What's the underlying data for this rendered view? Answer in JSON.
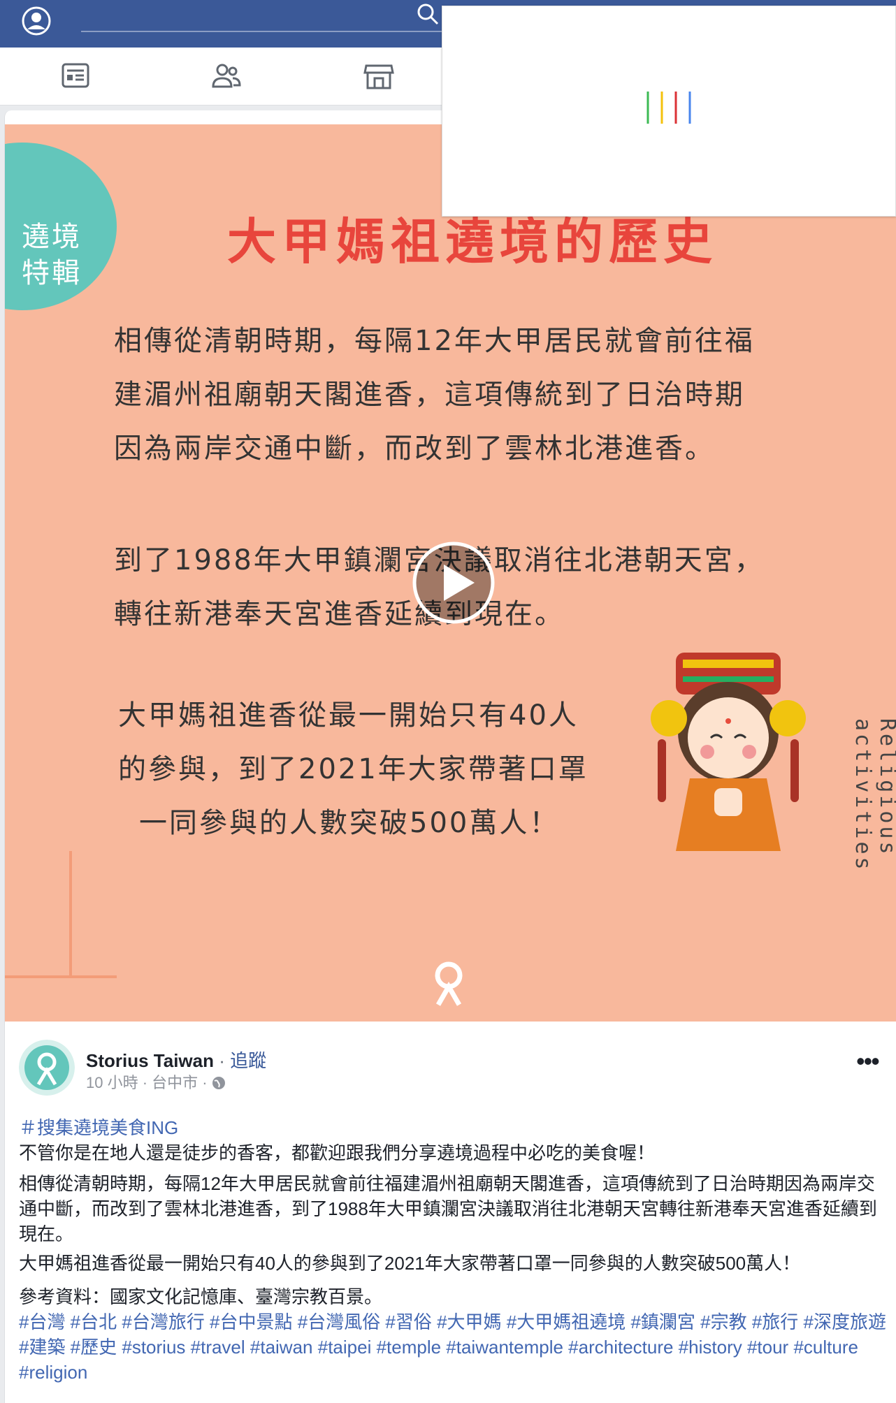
{
  "nav": {
    "icons": [
      "profile-icon",
      "search-icon",
      "news-feed-icon",
      "friends-icon",
      "marketplace-icon"
    ]
  },
  "video": {
    "badge": [
      "遶境",
      "特輯"
    ],
    "title": "大甲媽祖遶境的歷史",
    "para1": [
      "相傳從清朝時期，每隔12年大甲居民就會前往福",
      "建湄州祖廟朝天閣進香，這項傳統到了日治時期",
      "因為兩岸交通中斷，而改到了雲林北港進香。"
    ],
    "para2": [
      "到了1988年大甲鎮瀾宮決議取消往北港朝天宮，",
      "轉往新港奉天宮進香延續到現在。"
    ],
    "para3": [
      "大甲媽祖進香從最一開始只有40人",
      "的參與，到了2021年大家帶著口罩",
      "一同參與的人數突破500萬人！"
    ],
    "side_text": "Religious activities"
  },
  "post": {
    "author": "Storius Taiwan",
    "sep": "·",
    "follow": "追蹤",
    "meta": "10 小時 · 台中市 ·",
    "more": "•••",
    "hashtag_title": "＃搜集遶境美食ING",
    "line1": "不管你是在地人還是徒步的香客，都歡迎跟我們分享遶境過程中必吃的美食喔！",
    "para2": "相傳從清朝時期，每隔12年大甲居民就會前往福建湄州祖廟朝天閣進香，這項傳統到了日治時期因為兩岸交通中斷，而改到了雲林北港進香，到了1988年大甲鎮瀾宮決議取消往北港朝天宮轉往新港奉天宮進香延續到現在。",
    "para3": "大甲媽祖進香從最一開始只有40人的參與到了2021年大家帶著口罩一同參與的人數突破500萬人！",
    "reference": "參考資料：國家文化記憶庫、臺灣宗教百景。",
    "tags": "#台灣 #台北 #台灣旅行 #台中景點 #台灣風俗 #習俗 #大甲媽 #大甲媽祖遶境 #鎮瀾宮 #宗教 #旅行 #深度旅遊 #建築 #歷史 #storius #travel #taiwan #taipei #temple #taiwantemple #architecture #history #tour #culture #religion"
  },
  "colors": {
    "fb_blue": "#3b5998",
    "video_bg": "#f8b89c",
    "badge": "#63c6bb",
    "title_red": "#e8453c",
    "link": "#4267b2"
  }
}
